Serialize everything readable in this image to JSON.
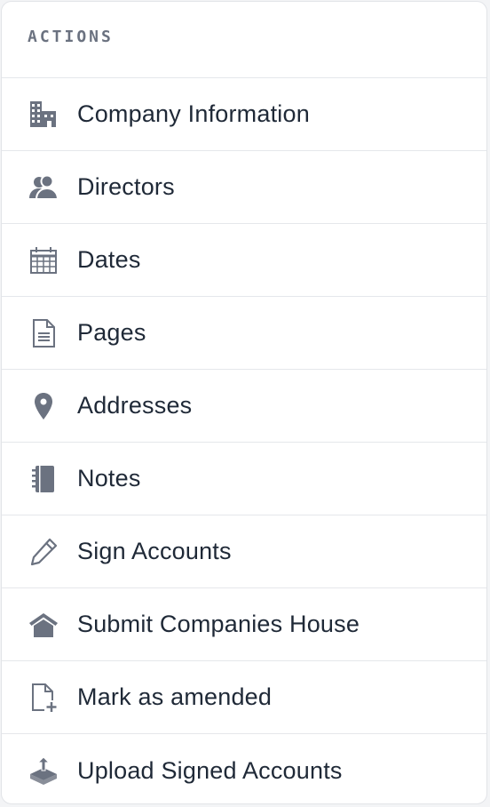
{
  "panel": {
    "title": "ACTIONS",
    "items": [
      {
        "label": "Company Information",
        "icon": "building-icon"
      },
      {
        "label": "Directors",
        "icon": "users-icon"
      },
      {
        "label": "Dates",
        "icon": "calendar-icon"
      },
      {
        "label": "Pages",
        "icon": "document-icon"
      },
      {
        "label": "Addresses",
        "icon": "map-pin-icon"
      },
      {
        "label": "Notes",
        "icon": "notebook-icon"
      },
      {
        "label": "Sign Accounts",
        "icon": "pencil-icon"
      },
      {
        "label": "Submit Companies House",
        "icon": "house-icon"
      },
      {
        "label": "Mark as amended",
        "icon": "file-plus-icon"
      },
      {
        "label": "Upload Signed Accounts",
        "icon": "upload-icon"
      }
    ]
  },
  "colors": {
    "icon": "#6b7280",
    "text": "#1f2937",
    "border": "#e5e7eb"
  }
}
